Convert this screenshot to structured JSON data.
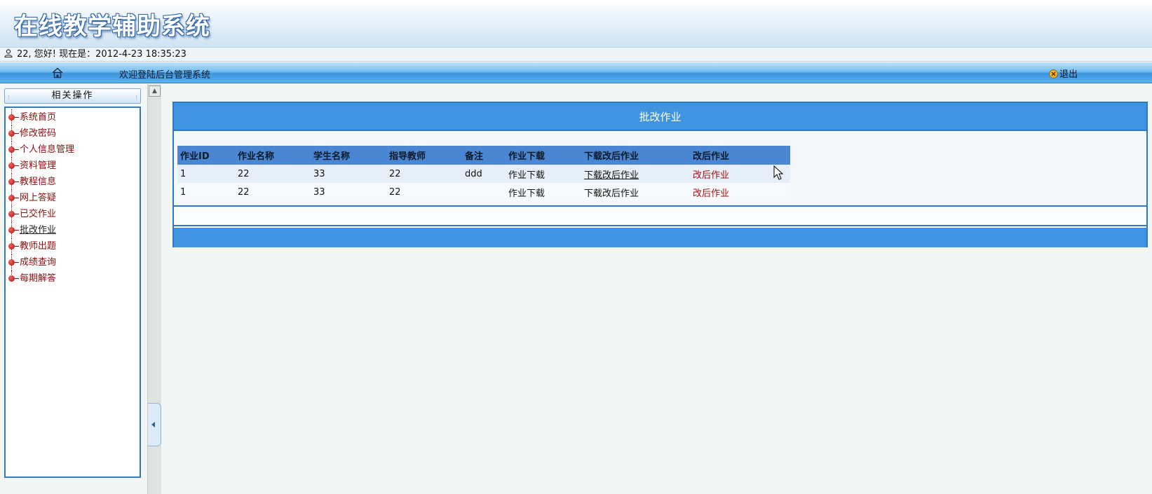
{
  "header": {
    "title": "在线教学辅助系统"
  },
  "userbar": {
    "text": "22, 您好! 现在是：2012-4-23 18:35:23"
  },
  "nav": {
    "welcome": "欢迎登陆后台管理系统",
    "logout": "退出"
  },
  "sidebar": {
    "title": "相关操作",
    "items": [
      {
        "label": "系统首页"
      },
      {
        "label": "修改密码"
      },
      {
        "label": "个人信息管理"
      },
      {
        "label": "资料管理"
      },
      {
        "label": "教程信息"
      },
      {
        "label": "网上答疑"
      },
      {
        "label": "已交作业"
      },
      {
        "label": "批改作业",
        "active": true
      },
      {
        "label": "教师出题"
      },
      {
        "label": "成绩查询"
      },
      {
        "label": "每期解答"
      }
    ]
  },
  "main": {
    "panel_title": "批改作业",
    "columns": [
      "作业ID",
      "作业名称",
      "学生名称",
      "指导教师",
      "备注",
      "作业下载",
      "下载改后作业",
      "改后作业"
    ],
    "rows": [
      [
        "1",
        "22",
        "33",
        "22",
        "ddd",
        "作业下载",
        "下载改后作业",
        "改后作业"
      ],
      [
        "1",
        "22",
        "33",
        "22",
        "",
        "作业下载",
        "下载改后作业",
        "改后作业"
      ]
    ]
  },
  "colors": {
    "header_blue": "#3f93e0",
    "link_red": "#a80f0f",
    "nav_blue": "#3b95dc"
  },
  "icons": [
    "user-icon",
    "home-icon",
    "logout-icon",
    "menu-bullet-icon",
    "scroll-up-icon",
    "collapse-arrow-icon",
    "mouse-cursor-icon"
  ]
}
